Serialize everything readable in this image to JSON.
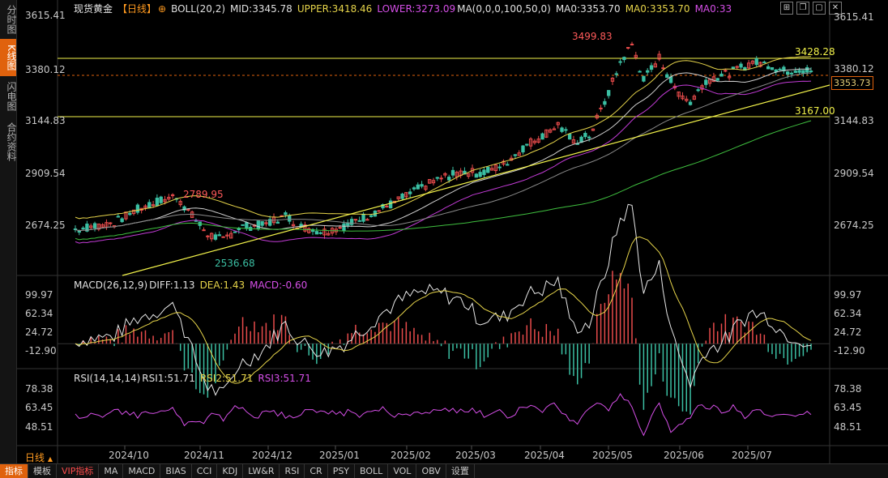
{
  "sidebar": {
    "tabs": [
      {
        "label": "分时图",
        "active": false
      },
      {
        "label": "K线图",
        "active": true
      },
      {
        "label": "闪电图",
        "active": false
      },
      {
        "label": "合约资料",
        "active": false
      }
    ]
  },
  "header": {
    "symbol": "现货黄金",
    "period_badge": "【日线】",
    "plus_icon": "⊕",
    "boll": "BOLL(20,2)",
    "mid": "MID:3345.78",
    "upper": "UPPER:3418.46",
    "lower": "LOWER:3273.09",
    "ma": "MA(0,0,0,100,50,0)",
    "ma0a": "MA0:3353.70",
    "ma0b": "MA0:3353.70",
    "ma0c": "MA0:33"
  },
  "window_buttons": [
    "⊞",
    "❐",
    "▢",
    "✕"
  ],
  "price_axis": [
    "3615.41",
    "3380.12",
    "3144.83",
    "2909.54",
    "2674.25"
  ],
  "price_tag": "3353.73",
  "annotations": {
    "high": "3499.83",
    "peak_early": "2789.95",
    "low": "2536.68",
    "upper_level": "3428.28",
    "lower_level": "3167.00"
  },
  "macd": {
    "title": "MACD(26,12,9)",
    "diff": "DIFF:1.13",
    "dea": "DEA:1.43",
    "macd": "MACD:-0.60",
    "axis": [
      "99.97",
      "62.34",
      "24.72",
      "-12.90"
    ]
  },
  "rsi": {
    "title": "RSI(14,14,14)",
    "rsi1": "RSI1:51.71",
    "rsi2": "RSI2:51.71",
    "rsi3": "RSI3:51.71",
    "axis": [
      "78.38",
      "63.45",
      "48.51"
    ]
  },
  "dates": [
    "2024/10",
    "2024/11",
    "2024/12",
    "2025/01",
    "2025/02",
    "2025/03",
    "2025/04",
    "2025/05",
    "2025/06",
    "2025/07"
  ],
  "period_label": "日线",
  "bottom_tabs": [
    {
      "label": "指标",
      "active": true,
      "vip": false
    },
    {
      "label": "模板",
      "active": false,
      "vip": false
    },
    {
      "label": "VIP指标",
      "active": false,
      "vip": true
    },
    {
      "label": "MA",
      "active": false,
      "vip": false
    },
    {
      "label": "MACD",
      "active": false,
      "vip": false
    },
    {
      "label": "BIAS",
      "active": false,
      "vip": false
    },
    {
      "label": "CCI",
      "active": false,
      "vip": false
    },
    {
      "label": "KDJ",
      "active": false,
      "vip": false
    },
    {
      "label": "LW&R",
      "active": false,
      "vip": false
    },
    {
      "label": "RSI",
      "active": false,
      "vip": false
    },
    {
      "label": "CR",
      "active": false,
      "vip": false
    },
    {
      "label": "PSY",
      "active": false,
      "vip": false
    },
    {
      "label": "BOLL",
      "active": false,
      "vip": false
    },
    {
      "label": "VOL",
      "active": false,
      "vip": false
    },
    {
      "label": "OBV",
      "active": false,
      "vip": false
    },
    {
      "label": "设置",
      "active": false,
      "vip": false
    }
  ],
  "colors": {
    "up": "#e84b4b",
    "down": "#3bbfa3",
    "upper": "#e6d44a",
    "mid": "#d0d0d0",
    "lower": "#c23bd6",
    "ma": "#8a8a8a",
    "green": "#3fbf3f",
    "trend": "#f2f24a"
  }
}
